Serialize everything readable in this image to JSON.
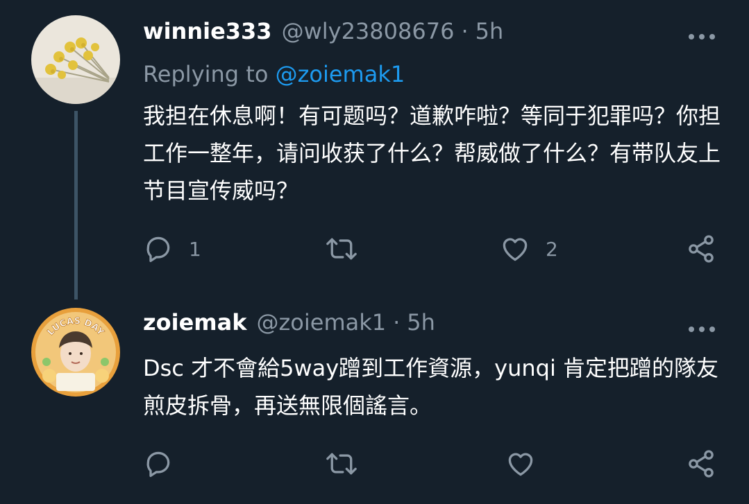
{
  "tweets": [
    {
      "name": "winnie333",
      "handle": "@wly23808676",
      "dot": "·",
      "time": "5h",
      "reply_prefix": "Replying to ",
      "reply_to": "@zoiemak1",
      "text": "我担在休息啊！有可题吗？道歉咋啦？等同于犯罪吗？你担工作一整年，请问收获了什么？帮威做了什么？有带队友上节目宣传威吗？",
      "reply_count": "1",
      "retweet_count": "",
      "like_count": "2"
    },
    {
      "name": "zoiemak",
      "handle": "@zoiemak1",
      "dot": "·",
      "time": "5h",
      "avatar_badge": "LUCAS DAY",
      "text": "Dsc 才不會給5way蹭到工作資源，yunqi 肯定把蹭的隊友煎皮拆骨，再送無限個謠言。",
      "reply_count": "",
      "retweet_count": "",
      "like_count": ""
    }
  ],
  "icons": [
    "more-icon",
    "reply-icon",
    "retweet-icon",
    "like-icon",
    "share-icon"
  ],
  "colors": {
    "background": "#15202b",
    "text_primary": "#ffffff",
    "text_secondary": "#8b98a5",
    "link": "#1d9bf0",
    "thread_line": "#3d5466"
  }
}
